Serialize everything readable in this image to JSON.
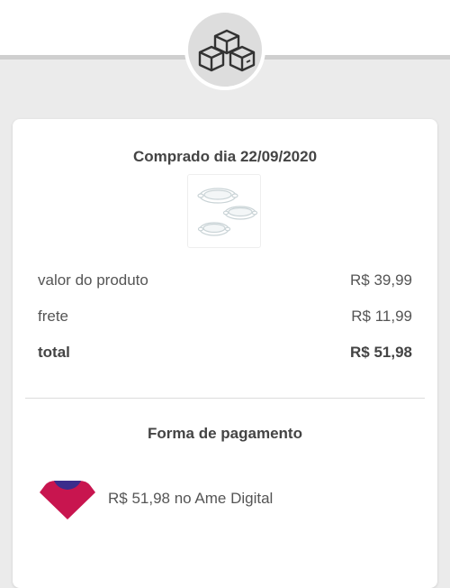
{
  "header": {
    "icon": "boxes-icon"
  },
  "order": {
    "purchased_label": "Comprado dia 22/09/2020",
    "product_image": "ceramic-bakeware-dishes-image"
  },
  "prices": [
    {
      "label": "valor do produto",
      "value": "R$ 39,99"
    },
    {
      "label": "frete",
      "value": "R$ 11,99"
    },
    {
      "label": "total",
      "value": "R$ 51,98"
    }
  ],
  "payment": {
    "title": "Forma de pagamento",
    "logo": "ame-digital-logo-icon",
    "text": "R$ 51,98 no Ame Digital"
  },
  "colors": {
    "background": "#ebebeb",
    "card": "#ffffff",
    "text": "#444444",
    "ame_pink": "#c8154f",
    "ame_blue": "#3b2d8c"
  }
}
